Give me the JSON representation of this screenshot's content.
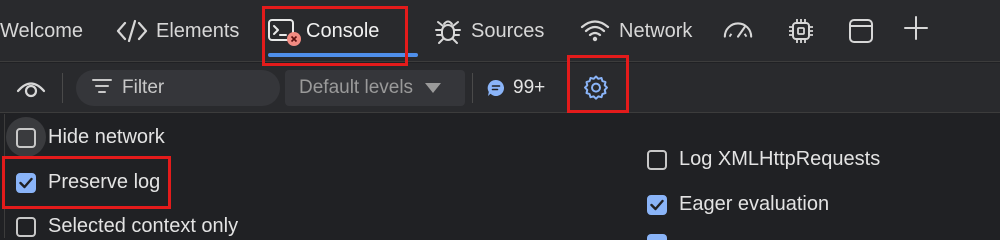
{
  "tabs": {
    "welcome": "Welcome",
    "elements": "Elements",
    "console": "Console",
    "sources": "Sources",
    "network": "Network"
  },
  "toolbar": {
    "filter_placeholder": "Filter",
    "levels_label": "Default levels",
    "message_count": "99+"
  },
  "settings": {
    "hide_network": {
      "label": "Hide network",
      "checked": false
    },
    "preserve_log": {
      "label": "Preserve log",
      "checked": true
    },
    "selected_context_only": {
      "label": "Selected context only",
      "checked": false
    },
    "log_xmlhttprequests": {
      "label": "Log XMLHttpRequests",
      "checked": false
    },
    "eager_evaluation": {
      "label": "Eager evaluation",
      "checked": true
    }
  },
  "colors": {
    "accent": "#4f8fea",
    "checkbox_on": "#8ab4f8",
    "highlight": "#e31b1b",
    "error_badge": "#f28b82"
  },
  "icons": [
    "code-brackets-icon",
    "console-icon",
    "error-badge-icon",
    "bug-icon",
    "wifi-icon",
    "performance-gauge-icon",
    "cpu-icon",
    "window-icon",
    "plus-icon",
    "eye-icon",
    "filter-lines-icon",
    "caret-down-icon",
    "message-bubble-icon",
    "gear-icon"
  ]
}
